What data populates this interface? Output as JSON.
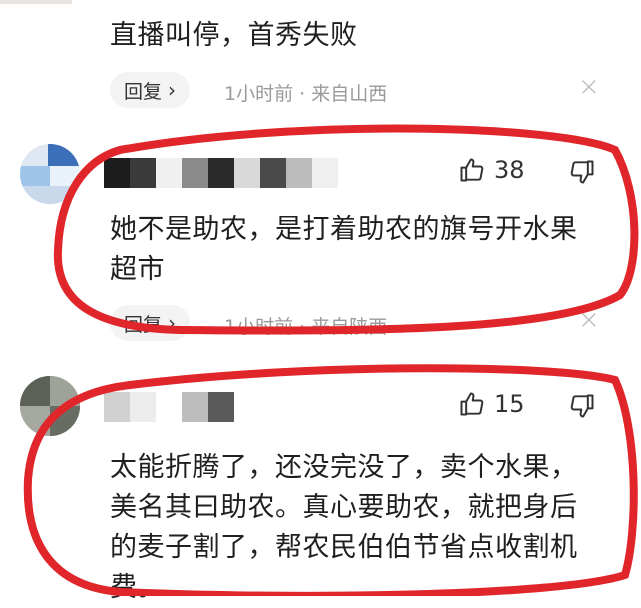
{
  "comments": [
    {
      "text": "直播叫停，首秀失败",
      "reply_label": "回复",
      "chevron": "›",
      "time_location": "1小时前 · 来自山西",
      "close": "×"
    },
    {
      "likes": "38",
      "text": "她不是助农，是打着助农的旗号开水果超市",
      "reply_label": "回复",
      "chevron": "›",
      "time_location": "1小时前 · 来自陕西",
      "close": "×"
    },
    {
      "likes": "15",
      "text": "太能折腾了，还没完没了，卖个水果，美名其曰助农。真心要助农，就把身后的麦子割了，帮农民伯伯节省点收割机费。"
    }
  ],
  "icons": {
    "like": "thumbs-up-icon",
    "dislike": "thumbs-down-icon",
    "close": "close-icon"
  },
  "colors": {
    "annotation_ring": "#e0262a",
    "pill_bg": "#f3f3f3",
    "meta_text": "#9a9a9a"
  }
}
